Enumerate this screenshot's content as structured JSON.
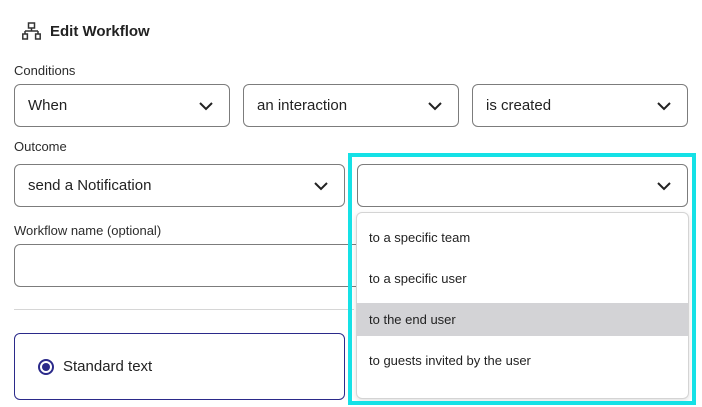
{
  "header": {
    "title": "Edit Workflow",
    "icon": "workflow-icon"
  },
  "conditions": {
    "label": "Conditions",
    "trigger_value": "When",
    "subject_value": "an interaction",
    "event_value": "is created"
  },
  "outcome": {
    "label": "Outcome",
    "action_value": "send a Notification",
    "target_value": ""
  },
  "workflow_name": {
    "label": "Workflow name (optional)",
    "value": "",
    "placeholder": ""
  },
  "message_type": {
    "selected_label": "Standard text"
  },
  "target_dropdown": {
    "options": [
      "to a specific team",
      "to a specific user",
      "to the end user",
      "to guests invited by the user"
    ],
    "highlighted_index": 2
  },
  "colors": {
    "highlight": "#15e1e6",
    "accent": "#2b2a8a",
    "hover": "#d3d3d6"
  }
}
